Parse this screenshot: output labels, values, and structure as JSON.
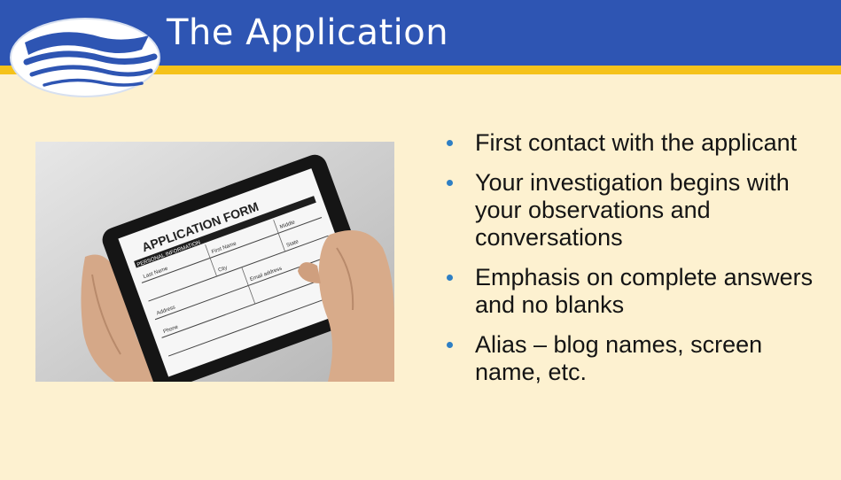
{
  "slide": {
    "title": "The Application",
    "bullets": [
      "First contact with the applicant",
      "Your investigation begins with your observations and conversations",
      "Emphasis on complete answers and no blanks",
      "Alias – blog names, screen name, etc."
    ],
    "form": {
      "heading": "APPLICATION FORM",
      "section": "PERSONAL INFORMATION",
      "fields": [
        "Last Name",
        "First Name",
        "Middle",
        "City",
        "State",
        "Address",
        "Email address",
        "Phone"
      ]
    }
  },
  "colors": {
    "title_bar": "#2e55b3",
    "accent_bar": "#f5c21a",
    "background": "#fdf1d0",
    "bullet": "#2e7fc4"
  },
  "icons": {
    "logo": "wave-logo-icon",
    "bullet": "bullet-dot-icon"
  }
}
